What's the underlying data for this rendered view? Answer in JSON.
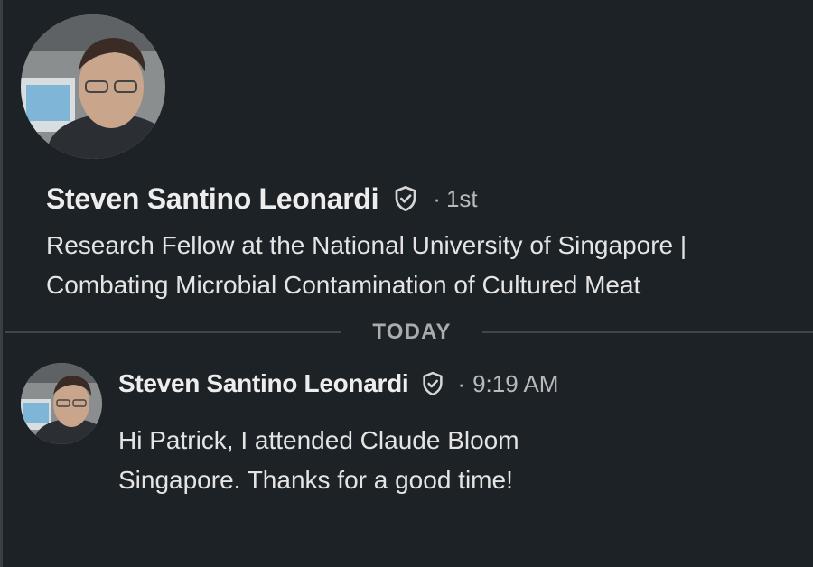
{
  "profile": {
    "name": "Steven Santino Leonardi",
    "degree_separator": "·",
    "degree": "1st",
    "headline": "Research Fellow at the National University of Singapore | Combating Microbial Contamination of Cultured Meat",
    "avatar_icon": "profile-photo",
    "verified_icon": "verified-shield-icon"
  },
  "divider": {
    "label": "TODAY"
  },
  "message": {
    "sender": "Steven Santino Leonardi",
    "separator": "·",
    "time": "9:19 AM",
    "text": "Hi Patrick, I attended Claude Bloom Singapore. Thanks for a good time!"
  },
  "colors": {
    "background": "#1d2226",
    "primary_text": "#ededed",
    "secondary_text": "#b8babc",
    "divider": "#40464b"
  }
}
